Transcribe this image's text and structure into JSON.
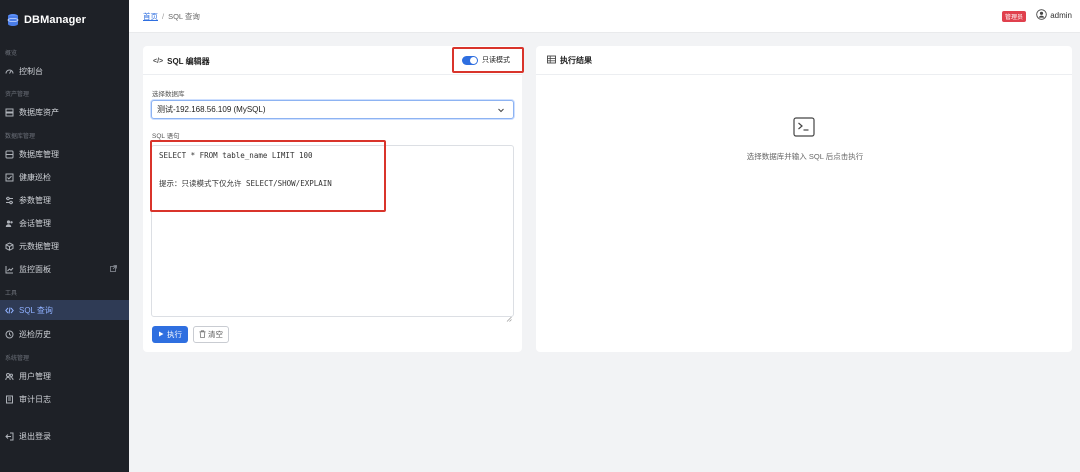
{
  "app": {
    "name": "DBManager"
  },
  "sidebar": {
    "sections": [
      {
        "label": "概览"
      },
      {
        "label": "资产管理"
      },
      {
        "label": "数据库管理"
      },
      {
        "label": "工具"
      },
      {
        "label": "系统管理"
      }
    ],
    "items": [
      {
        "label": "控制台",
        "icon": "dashboard-icon"
      },
      {
        "label": "数据库资产",
        "icon": "server-icon"
      },
      {
        "label": "数据库管理",
        "icon": "database-icon"
      },
      {
        "label": "健康巡检",
        "icon": "checklist-icon"
      },
      {
        "label": "参数管理",
        "icon": "sliders-icon"
      },
      {
        "label": "会话管理",
        "icon": "users-icon"
      },
      {
        "label": "元数据管理",
        "icon": "cube-icon"
      },
      {
        "label": "监控面板",
        "icon": "chart-icon",
        "external": true
      },
      {
        "label": "SQL 查询",
        "icon": "code-icon",
        "active": true
      },
      {
        "label": "巡检历史",
        "icon": "clock-icon"
      },
      {
        "label": "用户管理",
        "icon": "user-group-icon"
      },
      {
        "label": "审计日志",
        "icon": "log-icon"
      },
      {
        "label": "退出登录",
        "icon": "logout-icon"
      }
    ]
  },
  "header": {
    "breadcrumb_home": "首页",
    "breadcrumb_sep": "/",
    "breadcrumb_current": "SQL 查询",
    "role_badge": "管理员",
    "username": "admin"
  },
  "editor": {
    "title": "SQL 编辑器",
    "readonly_label": "只读模式",
    "readonly_on": true,
    "db_label": "选择数据库",
    "db_selected": "测试-192.168.56.109 (MySQL)",
    "sql_label": "SQL 语句",
    "sql_line1": "SELECT * FROM table_name LIMIT 100",
    "sql_line2": "提示：只读模式下仅允许 SELECT/SHOW/EXPLAIN",
    "run_label": "执行",
    "clear_label": "清空"
  },
  "results": {
    "title": "执行结果",
    "empty_text": "选择数据库并输入 SQL 后点击执行"
  },
  "colors": {
    "accent": "#2f6fe0",
    "sidebar_bg": "#1e2127",
    "highlight_red": "#d9342b",
    "badge_red": "#e0404d"
  }
}
